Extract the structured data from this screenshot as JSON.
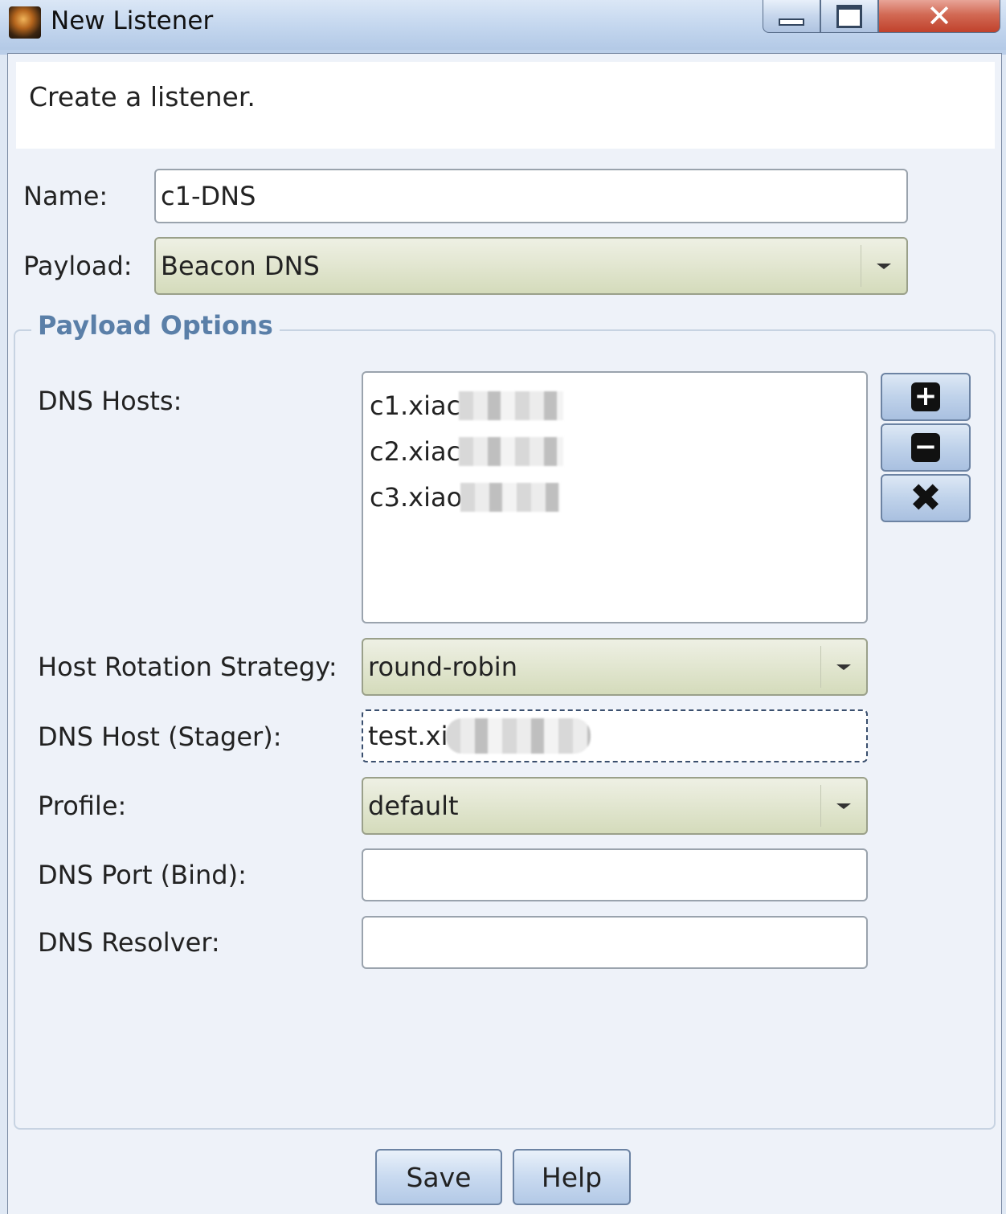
{
  "window": {
    "title": "New Listener",
    "minimize_label": "",
    "maximize_label": "",
    "close_label": "✕"
  },
  "header": {
    "text": "Create a listener."
  },
  "form": {
    "name_label": "Name:",
    "name_value": "c1-DNS",
    "payload_label": "Payload:",
    "payload_value": "Beacon DNS"
  },
  "payload_options": {
    "title": "Payload Options",
    "dns_hosts_label": "DNS Hosts:",
    "dns_hosts": [
      "c1.xiac",
      "c2.xiac",
      "c3.xiao"
    ],
    "add_icon": "plus-icon",
    "remove_icon": "minus-icon",
    "clear_icon": "x-icon",
    "rotation_label": "Host Rotation Strategy:",
    "rotation_value": "round-robin",
    "stager_label": "DNS Host (Stager):",
    "stager_value": "test.xi",
    "profile_label": "Profile:",
    "profile_value": "default",
    "port_label": "DNS Port (Bind):",
    "port_value": "",
    "resolver_label": "DNS Resolver:",
    "resolver_value": ""
  },
  "buttons": {
    "save": "Save",
    "help": "Help"
  }
}
